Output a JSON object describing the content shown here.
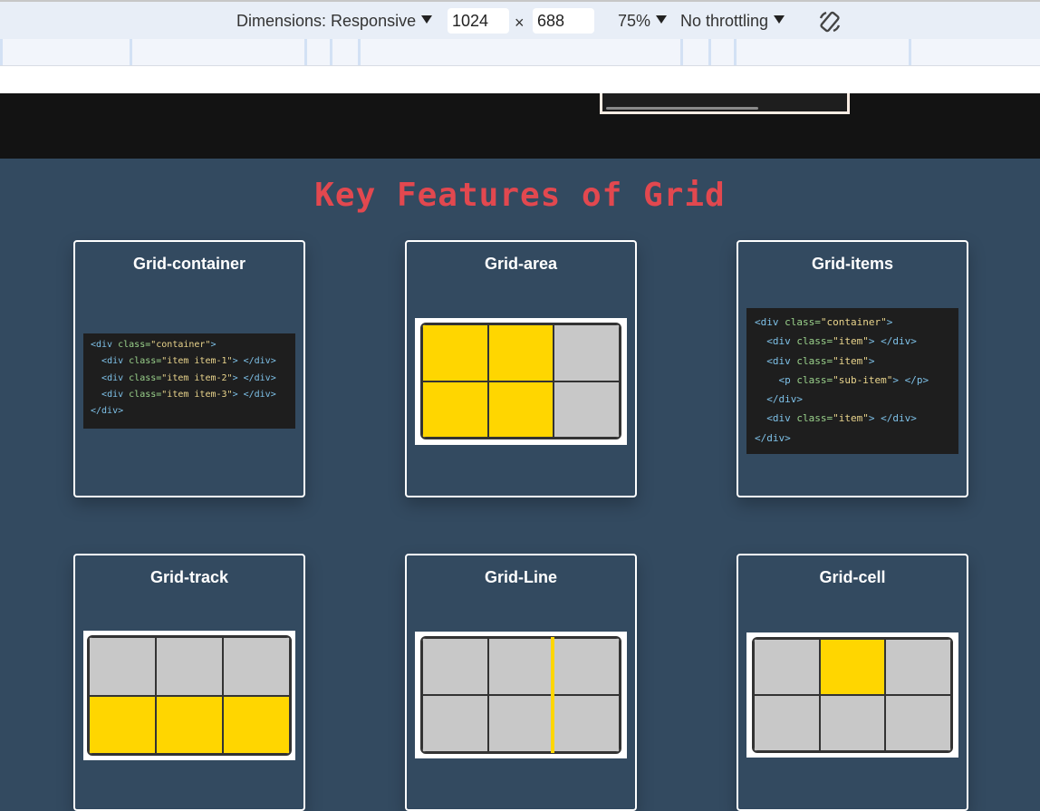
{
  "devtools": {
    "dimensions_label": "Dimensions: Responsive",
    "width_value": "1024",
    "times": "×",
    "height_value": "688",
    "zoom": "75%",
    "throttling": "No throttling",
    "rotate_icon": "rotate-icon"
  },
  "section": {
    "title": "Key Features of Grid"
  },
  "cards": [
    {
      "title": "Grid-container",
      "code": [
        {
          "indent": "",
          "parts": [
            [
              "tag",
              "<div "
            ],
            [
              "attr",
              "class="
            ],
            [
              "val",
              "\"container\""
            ],
            [
              "tag",
              ">"
            ]
          ]
        },
        {
          "indent": "  ",
          "parts": [
            [
              "tag",
              "<div "
            ],
            [
              "attr",
              "class="
            ],
            [
              "val",
              "\"item item-1\""
            ],
            [
              "tag",
              "> </div>"
            ]
          ]
        },
        {
          "indent": "  ",
          "parts": [
            [
              "tag",
              "<div "
            ],
            [
              "attr",
              "class="
            ],
            [
              "val",
              "\"item item-2\""
            ],
            [
              "tag",
              "> </div>"
            ]
          ]
        },
        {
          "indent": "  ",
          "parts": [
            [
              "tag",
              "<div "
            ],
            [
              "attr",
              "class="
            ],
            [
              "val",
              "\"item item-3\""
            ],
            [
              "tag",
              "> </div>"
            ]
          ]
        },
        {
          "indent": "",
          "parts": [
            [
              "tag",
              "</div>"
            ]
          ]
        }
      ]
    },
    {
      "title": "Grid-area",
      "highlight": [
        1,
        1,
        0,
        1,
        1,
        0
      ]
    },
    {
      "title": "Grid-items",
      "code": [
        {
          "indent": "",
          "parts": [
            [
              "tag",
              "<div "
            ],
            [
              "attr",
              "class="
            ],
            [
              "val",
              "\"container\""
            ],
            [
              "tag",
              ">"
            ]
          ]
        },
        {
          "indent": "  ",
          "parts": [
            [
              "tag",
              "<div "
            ],
            [
              "attr",
              "class="
            ],
            [
              "val",
              "\"item\""
            ],
            [
              "tag",
              "> </div>"
            ]
          ]
        },
        {
          "indent": "  ",
          "parts": [
            [
              "tag",
              "<div "
            ],
            [
              "attr",
              "class="
            ],
            [
              "val",
              "\"item\""
            ],
            [
              "tag",
              ">"
            ]
          ]
        },
        {
          "indent": "    ",
          "parts": [
            [
              "tag",
              "<p "
            ],
            [
              "attr",
              "class="
            ],
            [
              "val",
              "\"sub-item\""
            ],
            [
              "tag",
              "> </p>"
            ]
          ]
        },
        {
          "indent": "  ",
          "parts": [
            [
              "tag",
              "</div>"
            ]
          ]
        },
        {
          "indent": "  ",
          "parts": [
            [
              "tag",
              "<div "
            ],
            [
              "attr",
              "class="
            ],
            [
              "val",
              "\"item\""
            ],
            [
              "tag",
              "> </div>"
            ]
          ]
        },
        {
          "indent": "",
          "parts": [
            [
              "tag",
              "</div>"
            ]
          ]
        }
      ]
    },
    {
      "title": "Grid-track",
      "highlight": [
        0,
        0,
        0,
        1,
        1,
        1
      ]
    },
    {
      "title": "Grid-Line",
      "highlight": [
        0,
        0,
        0,
        0,
        0,
        0
      ],
      "line": "yellow-vertical"
    },
    {
      "title": "Grid-cell",
      "highlight": [
        0,
        1,
        0,
        0,
        0,
        0
      ]
    }
  ],
  "colors": {
    "section_bg": "#334a60",
    "title_red": "#e2484f",
    "grid_yellow": "#ffd600",
    "grid_gray": "#c8c8c8",
    "code_bg": "#1e1e1e"
  }
}
